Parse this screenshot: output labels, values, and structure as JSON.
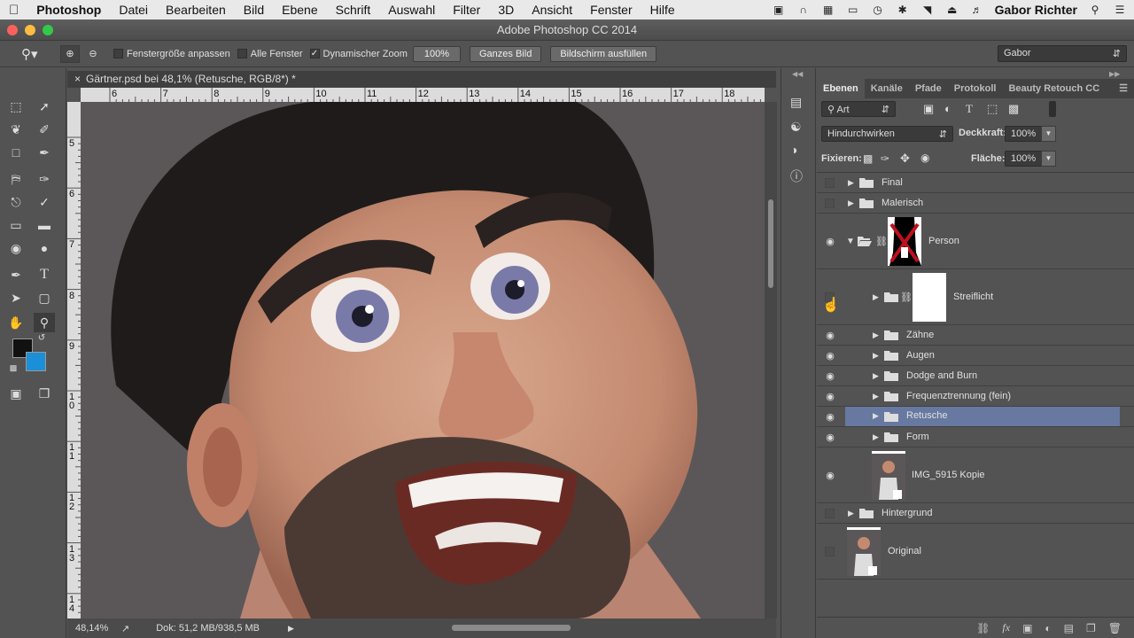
{
  "menubar": {
    "items": [
      "Photoshop",
      "Datei",
      "Bearbeiten",
      "Bild",
      "Ebene",
      "Schrift",
      "Auswahl",
      "Filter",
      "3D",
      "Ansicht",
      "Fenster",
      "Hilfe"
    ],
    "user": "Gabor Richter"
  },
  "window": {
    "title": "Adobe Photoshop CC 2014"
  },
  "options": {
    "fit_window": "Fenstergröße anpassen",
    "all_windows": "Alle Fenster",
    "scrubby_zoom": "Dynamischer Zoom",
    "zoom_100": "100%",
    "fit_screen": "Ganzes Bild",
    "fill_screen": "Bildschirm ausfüllen",
    "workspace": "Gabor"
  },
  "document": {
    "tab_title": "Gärtner.psd bei 48,1% (Retusche, RGB/8*) *",
    "ruler_h": [
      "6",
      "7",
      "8",
      "9",
      "10",
      "11",
      "12",
      "13",
      "14",
      "15",
      "16",
      "17",
      "18"
    ],
    "ruler_v": [
      "5",
      "6",
      "7",
      "8",
      "9",
      "1\n0",
      "1\n1",
      "1\n2",
      "1\n3",
      "1\n4"
    ]
  },
  "status": {
    "zoom": "48,14%",
    "doc": "Dok: 51,2 MB/938,5 MB"
  },
  "panel": {
    "tabs": [
      "Ebenen",
      "Kanäle",
      "Pfade",
      "Protokoll",
      "Beauty Retouch CC"
    ],
    "filter": "Art",
    "blend_mode": "Hindurchwirken",
    "opacity_label": "Deckkraft:",
    "opacity": "100%",
    "lock_label": "Fixieren:",
    "fill_label": "Fläche:",
    "fill": "100%",
    "layers": [
      {
        "name": "Final",
        "visible": false
      },
      {
        "name": "Malerisch",
        "visible": false
      },
      {
        "name": "Person",
        "visible": true
      },
      {
        "name": "Streiflicht",
        "visible": false
      },
      {
        "name": "Zähne",
        "visible": true
      },
      {
        "name": "Augen",
        "visible": true
      },
      {
        "name": "Dodge and Burn",
        "visible": true
      },
      {
        "name": "Frequenztrennung (fein)",
        "visible": true
      },
      {
        "name": "Retusche",
        "visible": true
      },
      {
        "name": "Form",
        "visible": true
      },
      {
        "name": "IMG_5915 Kopie",
        "visible": true
      },
      {
        "name": "Hintergrund",
        "visible": false
      },
      {
        "name": "Original",
        "visible": false
      }
    ]
  },
  "colors": {
    "foreground": "#111111",
    "background": "#1b8fd8",
    "selected_layer": "#6779a0"
  }
}
